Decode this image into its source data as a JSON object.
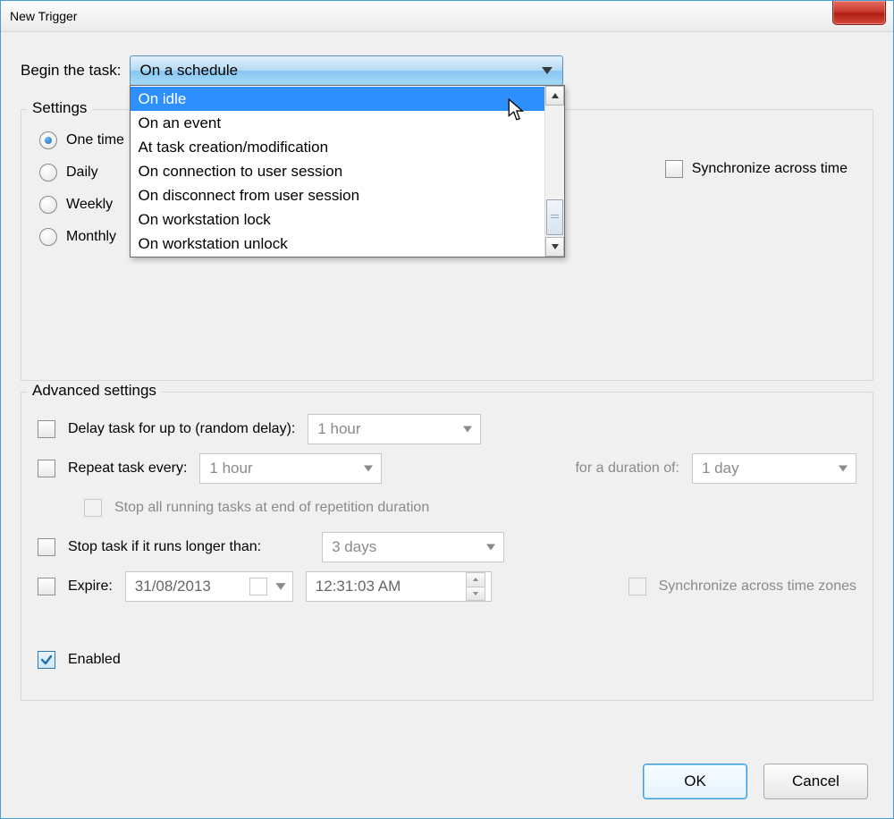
{
  "window": {
    "title": "New Trigger"
  },
  "begin": {
    "label": "Begin the task:",
    "selected": "On a schedule",
    "options": [
      "On idle",
      "On an event",
      "At task creation/modification",
      "On connection to user session",
      "On disconnect from user session",
      "On workstation lock",
      "On workstation unlock"
    ],
    "highlighted_index": 0
  },
  "settings": {
    "legend": "Settings",
    "frequencies": [
      {
        "label": "One time",
        "checked": true
      },
      {
        "label": "Daily",
        "checked": false
      },
      {
        "label": "Weekly",
        "checked": false
      },
      {
        "label": "Monthly",
        "checked": false
      }
    ],
    "sync_label": "Synchronize across time"
  },
  "advanced": {
    "legend": "Advanced settings",
    "delay": {
      "label": "Delay task for up to (random delay):",
      "value": "1 hour",
      "checked": false
    },
    "repeat": {
      "label": "Repeat task every:",
      "value": "1 hour",
      "checked": false,
      "duration_label": "for a duration of:",
      "duration_value": "1 day"
    },
    "stop_all": {
      "label": "Stop all running tasks at end of repetition duration",
      "checked": false
    },
    "stop_if": {
      "label": "Stop task if it runs longer than:",
      "value": "3 days",
      "checked": false
    },
    "expire": {
      "label": "Expire:",
      "date": "31/08/2013",
      "time": "12:31:03 AM",
      "checked": false,
      "sync_label": "Synchronize across time zones"
    },
    "enabled": {
      "label": "Enabled",
      "checked": true
    }
  },
  "buttons": {
    "ok": "OK",
    "cancel": "Cancel"
  }
}
